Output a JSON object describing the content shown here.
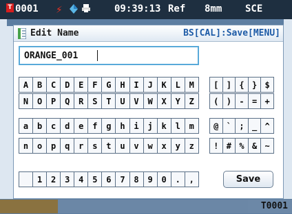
{
  "status": {
    "sample_id": "0001",
    "badge": "T",
    "clock": "09:39:13",
    "ref": "Ref",
    "aperture": "8mm",
    "mode": "SCE",
    "icons": [
      "lightning-icon",
      "diamond-icon",
      "printer-icon"
    ],
    "bolt_color": "#e63222",
    "badge_color": "#d61e1e"
  },
  "dialog": {
    "title": "Edit Name",
    "hint": "BS[CAL]:Save[MENU]",
    "name_value": "ORANGE_001",
    "save_label": "Save"
  },
  "keyboard": {
    "upper1": [
      "A",
      "B",
      "C",
      "D",
      "E",
      "F",
      "G",
      "H",
      "I",
      "J",
      "K",
      "L",
      "M"
    ],
    "upper2": [
      "N",
      "O",
      "P",
      "Q",
      "R",
      "S",
      "T",
      "U",
      "V",
      "W",
      "X",
      "Y",
      "Z"
    ],
    "lower1": [
      "a",
      "b",
      "c",
      "d",
      "e",
      "f",
      "g",
      "h",
      "i",
      "j",
      "k",
      "l",
      "m"
    ],
    "lower2": [
      "n",
      "o",
      "p",
      "q",
      "r",
      "s",
      "t",
      "u",
      "v",
      "w",
      "x",
      "y",
      "z"
    ],
    "digits": [
      "",
      "1",
      "2",
      "3",
      "4",
      "5",
      "6",
      "7",
      "8",
      "9",
      "0",
      ".",
      ","
    ],
    "sym1": [
      "[",
      "]",
      "{",
      "}",
      "$"
    ],
    "sym2": [
      "(",
      ")",
      "-",
      "=",
      "+"
    ],
    "sym3": [
      "@",
      "`",
      ";",
      "_",
      "^"
    ],
    "sym4": [
      "!",
      "#",
      "%",
      "&",
      "~"
    ]
  },
  "footer": {
    "target_label": "T0001"
  },
  "colors": {
    "accent": "#1c5aa6",
    "field_border": "#58a9d9",
    "statusbar": "#1e2f40"
  }
}
